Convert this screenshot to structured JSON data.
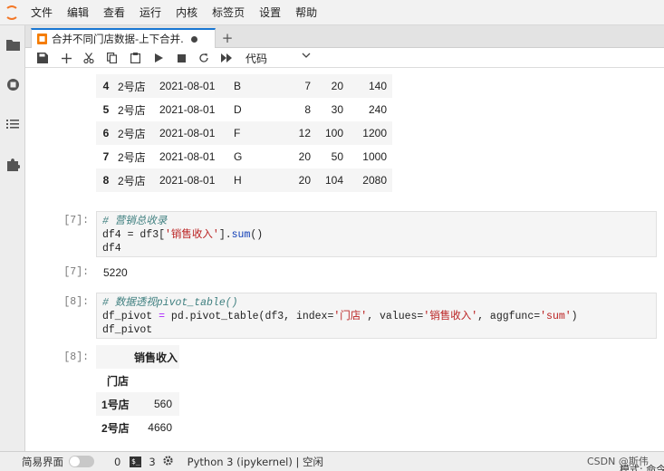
{
  "menu": [
    "文件",
    "编辑",
    "查看",
    "运行",
    "内核",
    "标签页",
    "设置",
    "帮助"
  ],
  "tab": {
    "title": "合并不同门店数据-上下合并."
  },
  "toolbar": {
    "cell_type": "代码"
  },
  "table1": {
    "rows": [
      {
        "index": "4",
        "store": "2号店",
        "date": "2021-08-01",
        "product": "B",
        "price": "7",
        "qty": "20",
        "revenue": "140"
      },
      {
        "index": "5",
        "store": "2号店",
        "date": "2021-08-01",
        "product": "D",
        "price": "8",
        "qty": "30",
        "revenue": "240"
      },
      {
        "index": "6",
        "store": "2号店",
        "date": "2021-08-01",
        "product": "F",
        "price": "12",
        "qty": "100",
        "revenue": "1200"
      },
      {
        "index": "7",
        "store": "2号店",
        "date": "2021-08-01",
        "product": "G",
        "price": "20",
        "qty": "50",
        "revenue": "1000"
      },
      {
        "index": "8",
        "store": "2号店",
        "date": "2021-08-01",
        "product": "H",
        "price": "20",
        "qty": "104",
        "revenue": "2080"
      }
    ]
  },
  "cell7": {
    "prompt_in": "[7]:",
    "comment": "# 营销总收录",
    "line2_a": "df4 = df3[",
    "line2_str": "'销售收入'",
    "line2_b": "].",
    "line2_fn": "sum",
    "line2_c": "()",
    "line3": "df4",
    "prompt_out": "[7]:",
    "output": "5220"
  },
  "cell8": {
    "prompt_in": "[8]:",
    "comment": "# 数据透视pivot_table()",
    "line2_a": "df_pivot ",
    "line2_eq": "=",
    "line2_b": " pd.pivot_table(df3, index=",
    "line2_s1": "'门店'",
    "line2_c": ", values=",
    "line2_s2": "'销售收入'",
    "line2_d": ", aggfunc=",
    "line2_s3": "'sum'",
    "line2_e": ")",
    "line3": "df_pivot",
    "prompt_out": "[8]:"
  },
  "pivot": {
    "column": "销售收入",
    "index_name": "门店",
    "rows": [
      {
        "store": "1号店",
        "value": "560"
      },
      {
        "store": "2号店",
        "value": "4660"
      }
    ]
  },
  "status": {
    "simple_mode": "简易界面",
    "count_a": "0",
    "count_b": "3",
    "kernel": "Python 3 (ipykernel) | 空闲",
    "mode": "模式: 命令",
    "watermark": "CSDN @斯伟"
  }
}
